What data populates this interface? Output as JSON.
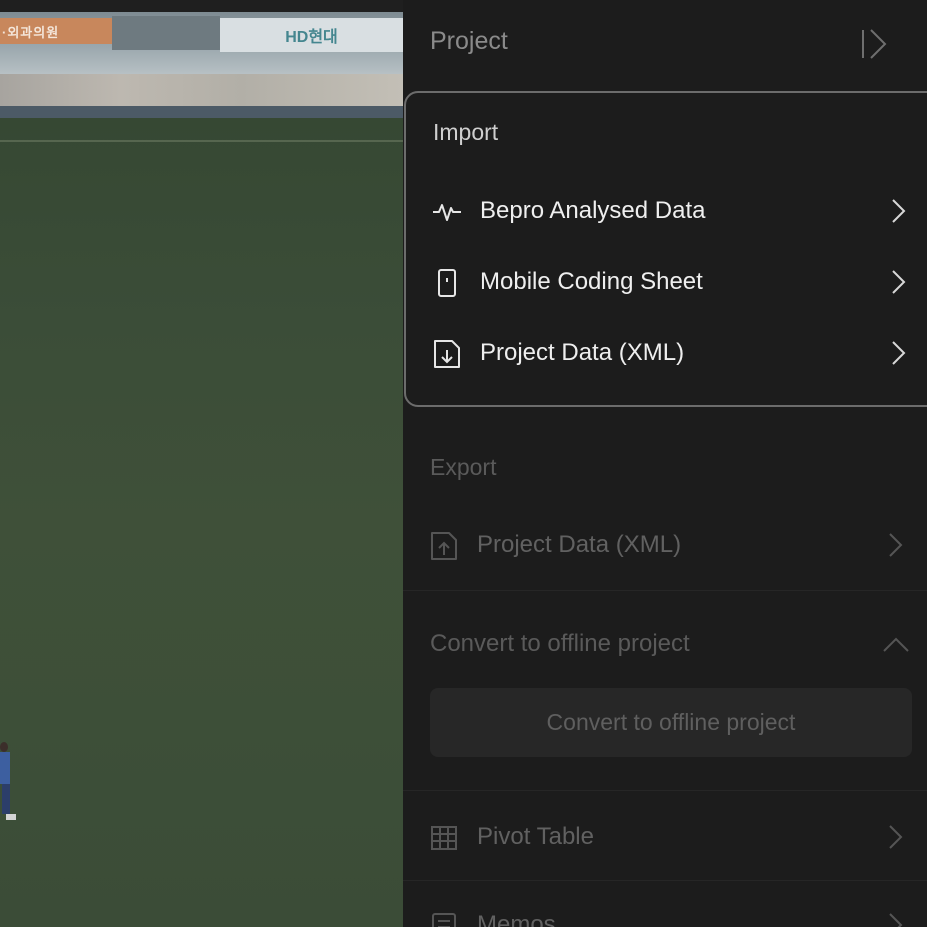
{
  "video": {
    "banner_left_text": "·외과의원",
    "banner_sponsor_text": "HD현대"
  },
  "panel": {
    "title": "Project",
    "collapse_icon": "panel-collapse-icon"
  },
  "import": {
    "title": "Import",
    "items": [
      {
        "label": "Bepro Analysed Data",
        "icon": "activity-pulse-icon"
      },
      {
        "label": "Mobile Coding Sheet",
        "icon": "mobile-phone-icon"
      },
      {
        "label": "Project Data (XML)",
        "icon": "file-download-icon"
      }
    ]
  },
  "export": {
    "title": "Export",
    "items": [
      {
        "label": "Project Data (XML)",
        "icon": "file-upload-icon"
      }
    ]
  },
  "convert": {
    "title": "Convert to offline project",
    "button_label": "Convert to offline project",
    "expanded": true
  },
  "tools": {
    "items": [
      {
        "label": "Pivot Table",
        "icon": "grid-table-icon"
      },
      {
        "label": "Memos",
        "icon": "memo-icon"
      }
    ]
  },
  "colors": {
    "panel_bg": "#1c1c1c",
    "active_text": "#efefef",
    "dim_text": "#616161",
    "highlight_border": "#6c6c6c"
  }
}
